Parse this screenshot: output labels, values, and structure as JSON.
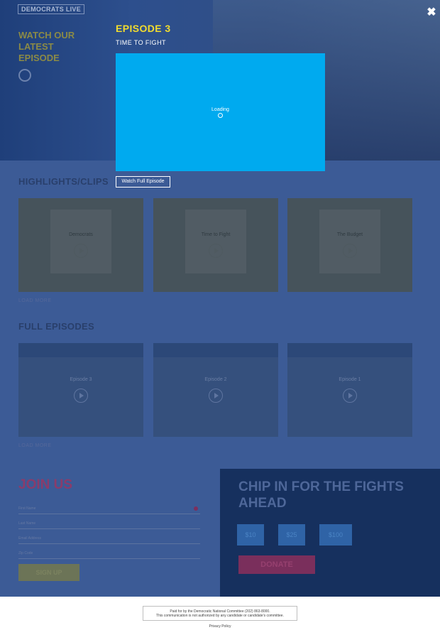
{
  "background_page": {
    "logo_text": "DEMOCRATS LIVE",
    "hero_title": "WATCH OUR LATEST EPISODE",
    "highlights": {
      "title": "HIGHLIGHTS/CLIPS",
      "items": [
        {
          "label": "Democrats"
        },
        {
          "label": "Time to Fight"
        },
        {
          "label": "The Budget"
        }
      ],
      "load_more": "LOAD MORE"
    },
    "episodes": {
      "title": "FULL EPISODES",
      "items": [
        {
          "label": "Episode 3"
        },
        {
          "label": "Episode 2"
        },
        {
          "label": "Episode 1"
        }
      ],
      "load_more": "LOAD MORE"
    },
    "join": {
      "title": "JOIN US",
      "fields": [
        "First Name",
        "Last Name",
        "Email Address",
        "Zip Code"
      ],
      "signup_label": "SIGN UP"
    },
    "chip": {
      "title": "CHIP IN FOR THE FIGHTS AHEAD",
      "amounts": [
        "$10",
        "$25",
        "$100"
      ],
      "donate_label": "DONATE"
    }
  },
  "modal": {
    "episode_title": "EPISODE 3",
    "episode_subtitle": "TIME TO FIGHT",
    "loading_text": "Loading",
    "watch_button": "Watch Full Episode",
    "close_icon": "close-icon",
    "accent_color": "#f2dc2e",
    "player_color": "#00aaef"
  },
  "footer": {
    "paid_line_1": "Paid for by the Democratic National Committee (202) 863-8000.",
    "paid_line_2": "This communication is not authorized by any candidate or candidate's committee.",
    "privacy": "Privacy Policy"
  }
}
